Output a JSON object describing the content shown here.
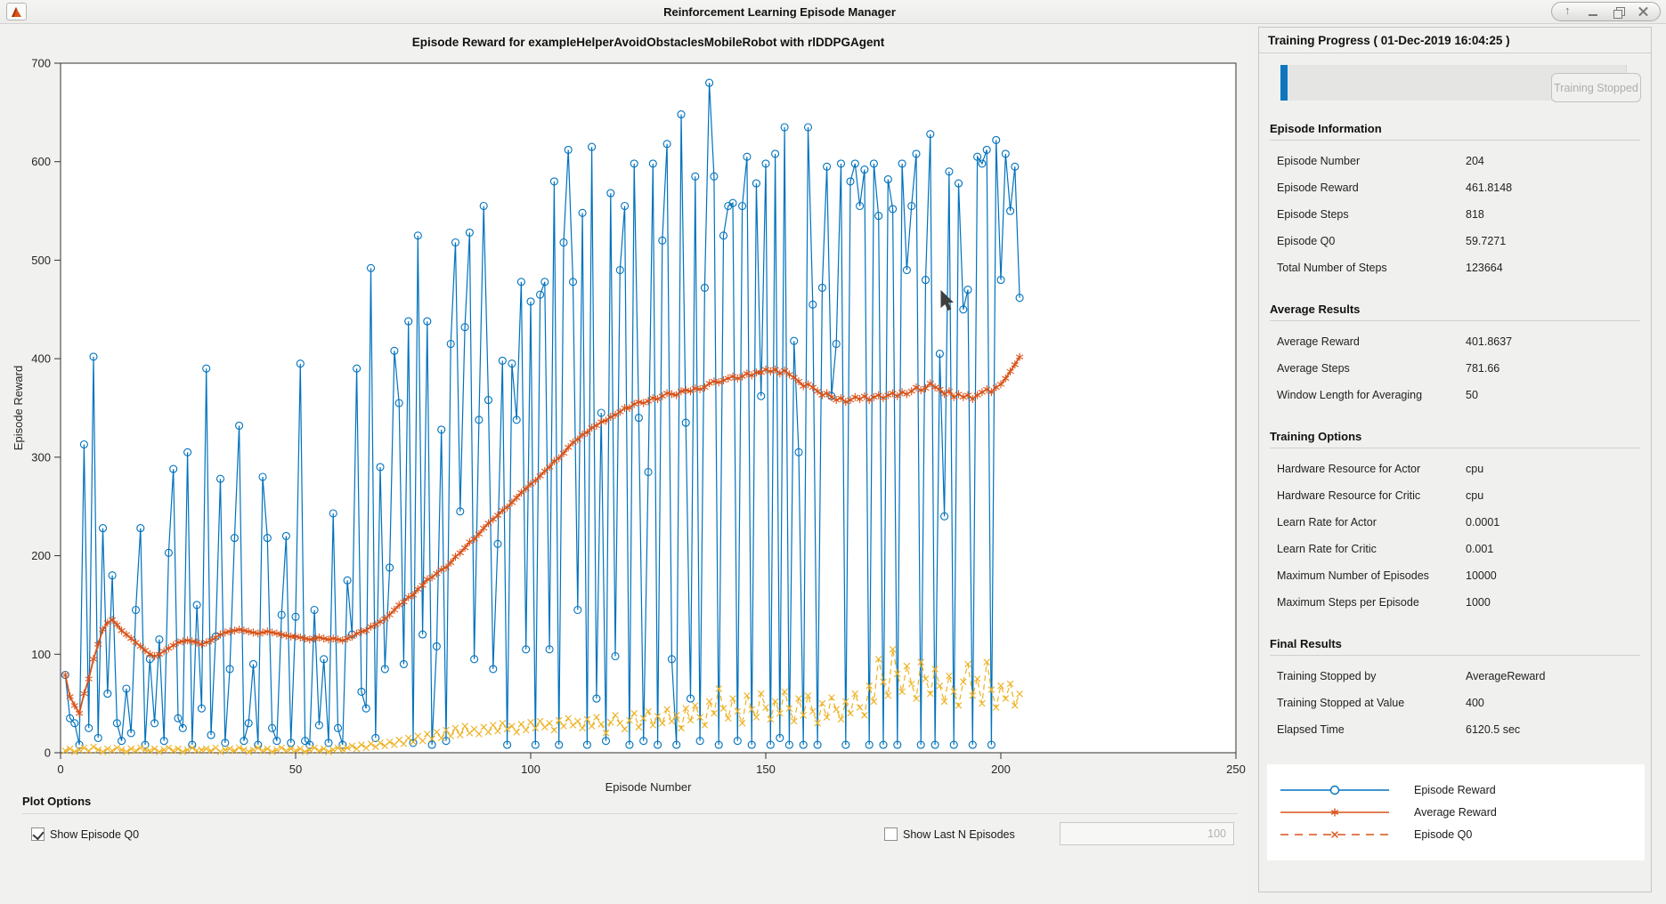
{
  "window": {
    "title": "Reinforcement Learning Episode Manager",
    "app_icon": "matlab-icon",
    "controls": [
      "shade-icon",
      "minimize-icon",
      "restore-icon",
      "close-icon"
    ]
  },
  "chart": {
    "title": "Episode Reward for exampleHelperAvoidObstaclesMobileRobot with rlDDPGAgent",
    "xlabel": "Episode Number",
    "ylabel": "Episode Reward",
    "x_ticks": [
      0,
      50,
      100,
      150,
      200,
      250
    ],
    "y_ticks": [
      0,
      100,
      200,
      300,
      400,
      500,
      600,
      700
    ]
  },
  "chart_data": {
    "type": "line",
    "x_start": 1,
    "xlim": [
      0,
      250
    ],
    "ylim": [
      0,
      700
    ],
    "grid": false,
    "series": [
      {
        "name": "Episode Reward",
        "color": "#0072BD",
        "marker": "circle",
        "style": "solid",
        "values": [
          79,
          35,
          30,
          8,
          313,
          25,
          402,
          15,
          228,
          60,
          180,
          30,
          12,
          65,
          20,
          145,
          228,
          8,
          95,
          30,
          115,
          12,
          203,
          288,
          35,
          25,
          305,
          8,
          150,
          45,
          390,
          18,
          118,
          278,
          10,
          85,
          218,
          332,
          12,
          30,
          90,
          8,
          280,
          218,
          25,
          12,
          140,
          220,
          10,
          138,
          395,
          12,
          8,
          145,
          28,
          95,
          10,
          243,
          25,
          8,
          175,
          120,
          390,
          62,
          45,
          492,
          15,
          290,
          85,
          188,
          408,
          355,
          90,
          438,
          10,
          525,
          120,
          438,
          8,
          108,
          328,
          12,
          415,
          518,
          245,
          432,
          528,
          95,
          338,
          555,
          358,
          85,
          212,
          398,
          8,
          395,
          338,
          478,
          105,
          458,
          8,
          465,
          478,
          105,
          580,
          8,
          518,
          612,
          478,
          145,
          548,
          8,
          615,
          55,
          345,
          12,
          568,
          98,
          490,
          555,
          8,
          598,
          340,
          12,
          285,
          598,
          8,
          520,
          618,
          95,
          8,
          648,
          335,
          55,
          585,
          12,
          472,
          680,
          585,
          8,
          525,
          555,
          558,
          12,
          555,
          605,
          8,
          578,
          362,
          598,
          8,
          608,
          15,
          635,
          8,
          418,
          305,
          8,
          635,
          455,
          8,
          472,
          595,
          362,
          415,
          598,
          8,
          580,
          598,
          555,
          592,
          8,
          598,
          545,
          8,
          582,
          552,
          8,
          598,
          490,
          555,
          608,
          8,
          480,
          628,
          8,
          405,
          240,
          590,
          8,
          578,
          450,
          470,
          8,
          605,
          598,
          612,
          8,
          622,
          480,
          608,
          550,
          595,
          461.8148
        ]
      },
      {
        "name": "Average Reward",
        "color": "#D95319",
        "marker": "asterisk",
        "style": "solid",
        "values": [
          79,
          57,
          48,
          40,
          60,
          75,
          95,
          110,
          125,
          132,
          135,
          130,
          124,
          120,
          116,
          112,
          108,
          104,
          100,
          98,
          100,
          103,
          106,
          109,
          112,
          113,
          114,
          113,
          112,
          110,
          112,
          114,
          117,
          120,
          122,
          123,
          124,
          125,
          124,
          123,
          122,
          121,
          122,
          123,
          122,
          121,
          120,
          119,
          118,
          118,
          117,
          116,
          115,
          116,
          117,
          116,
          115,
          116,
          115,
          114,
          116,
          118,
          121,
          123,
          124,
          128,
          130,
          133,
          136,
          140,
          145,
          150,
          153,
          158,
          160,
          166,
          170,
          176,
          178,
          182,
          186,
          188,
          193,
          199,
          203,
          208,
          214,
          217,
          222,
          228,
          233,
          237,
          241,
          246,
          249,
          254,
          259,
          264,
          268,
          273,
          276,
          281,
          286,
          290,
          296,
          299,
          304,
          310,
          315,
          318,
          323,
          325,
          330,
          332,
          336,
          337,
          341,
          343,
          346,
          350,
          350,
          354,
          356,
          355,
          357,
          360,
          359,
          362,
          365,
          364,
          363,
          367,
          368,
          367,
          370,
          369,
          371,
          375,
          377,
          376,
          378,
          380,
          382,
          380,
          382,
          385,
          383,
          386,
          386,
          389,
          387,
          389,
          385,
          388,
          384,
          381,
          377,
          372,
          374,
          371,
          367,
          363,
          365,
          361,
          358,
          360,
          356,
          358,
          361,
          359,
          362,
          358,
          361,
          363,
          360,
          363,
          365,
          362,
          366,
          364,
          367,
          371,
          368,
          370,
          375,
          371,
          369,
          364,
          367,
          361,
          364,
          361,
          363,
          359,
          363,
          366,
          369,
          366,
          371,
          374,
          380,
          387,
          394,
          401.8637
        ]
      },
      {
        "name": "Episode Q0",
        "color": "#EDB120",
        "marker": "x",
        "style": "dashed",
        "values": [
          2,
          4,
          1,
          3,
          5,
          2,
          6,
          3,
          1,
          4,
          2,
          5,
          3,
          1,
          4,
          2,
          5,
          3,
          2,
          4,
          1,
          3,
          5,
          2,
          4,
          1,
          3,
          5,
          2,
          3,
          4,
          2,
          5,
          1,
          3,
          4,
          2,
          5,
          3,
          1,
          3,
          5,
          2,
          4,
          1,
          3,
          5,
          2,
          4,
          2,
          4,
          1,
          3,
          5,
          2,
          4,
          1,
          3,
          5,
          3,
          5,
          7,
          4,
          8,
          5,
          9,
          6,
          10,
          7,
          11,
          8,
          13,
          9,
          15,
          11,
          17,
          12,
          19,
          14,
          21,
          15,
          23,
          17,
          25,
          18,
          27,
          20,
          24,
          19,
          26,
          21,
          28,
          22,
          30,
          24,
          27,
          21,
          29,
          23,
          31,
          25,
          32,
          26,
          30,
          23,
          33,
          27,
          35,
          28,
          32,
          25,
          34,
          27,
          36,
          29,
          20,
          31,
          38,
          30,
          24,
          33,
          40,
          26,
          35,
          42,
          28,
          37,
          30,
          44,
          32,
          38,
          25,
          45,
          33,
          48,
          36,
          28,
          52,
          40,
          65,
          45,
          35,
          55,
          42,
          30,
          58,
          44,
          36,
          60,
          46,
          34,
          52,
          40,
          62,
          45,
          32,
          55,
          38,
          58,
          42,
          30,
          50,
          36,
          56,
          44,
          34,
          52,
          40,
          60,
          46,
          38,
          68,
          52,
          95,
          72,
          58,
          105,
          80,
          62,
          88,
          70,
          55,
          92,
          75,
          60,
          85,
          68,
          52,
          78,
          62,
          48,
          72,
          90,
          58,
          75,
          50,
          92,
          64,
          46,
          68,
          55,
          70,
          48,
          59.7271
        ]
      }
    ]
  },
  "plot_options": {
    "title": "Plot Options",
    "show_q0_label": "Show Episode Q0",
    "show_q0_checked": true,
    "show_last_label": "Show Last N Episodes",
    "show_last_checked": false,
    "last_n_value": "100"
  },
  "panel": {
    "header": "Training Progress ( 01-Dec-2019 16:04:25 )",
    "progress_button": "Training Stopped",
    "progress_fill_pct": 2,
    "sections": [
      {
        "title": "Episode Information",
        "rows": [
          {
            "label": "Episode Number",
            "value": "204"
          },
          {
            "label": "Episode Reward",
            "value": "461.8148"
          },
          {
            "label": "Episode Steps",
            "value": "818"
          },
          {
            "label": "Episode Q0",
            "value": "59.7271"
          },
          {
            "label": "Total Number of Steps",
            "value": "123664"
          }
        ]
      },
      {
        "title": "Average Results",
        "rows": [
          {
            "label": "Average Reward",
            "value": "401.8637"
          },
          {
            "label": "Average Steps",
            "value": "781.66"
          },
          {
            "label": "Window Length for Averaging",
            "value": "50"
          }
        ]
      },
      {
        "title": "Training Options",
        "rows": [
          {
            "label": "Hardware Resource for Actor",
            "value": "cpu"
          },
          {
            "label": "Hardware Resource for Critic",
            "value": "cpu"
          },
          {
            "label": "Learn Rate for Actor",
            "value": "0.0001"
          },
          {
            "label": "Learn Rate for Critic",
            "value": "0.001"
          },
          {
            "label": "Maximum Number of Episodes",
            "value": "10000"
          },
          {
            "label": "Maximum Steps per Episode",
            "value": "1000"
          }
        ]
      },
      {
        "title": "Final Results",
        "rows": [
          {
            "label": "Training Stopped by",
            "value": "AverageReward"
          },
          {
            "label": "Training Stopped at Value",
            "value": "400"
          },
          {
            "label": "Elapsed Time",
            "value": "6120.5 sec"
          }
        ]
      }
    ],
    "legend": [
      {
        "label": "Episode Reward",
        "color": "#0072BD",
        "marker": "circle",
        "style": "solid"
      },
      {
        "label": "Average Reward",
        "color": "#D95319",
        "marker": "asterisk",
        "style": "solid"
      },
      {
        "label": "Episode Q0",
        "color": "#D95319",
        "marker": "x",
        "style": "dashed"
      }
    ]
  },
  "colors": {
    "blue": "#0072BD",
    "orange": "#D95319",
    "yellow": "#EDB120",
    "figure_bg": "#F1F1EF",
    "axes_bg": "#FFFFFF",
    "axis_line": "#333333",
    "progress_blue": "#0E76BE"
  }
}
